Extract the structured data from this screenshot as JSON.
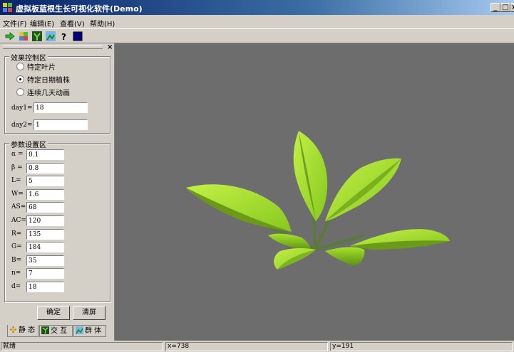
{
  "window": {
    "title": "虚拟板蓝根生长可视化软件(Demo)",
    "minimize_label": "_",
    "maximize_label": "□",
    "close_label": "×"
  },
  "menu": [
    {
      "label": "文件(F)"
    },
    {
      "label": "编辑(E)"
    },
    {
      "label": "查看(V)"
    },
    {
      "label": "帮助(H)"
    }
  ],
  "toolbar": {
    "icons": [
      "arrow-right-icon",
      "grid-icon",
      "plant-icon",
      "image-icon",
      "help-icon",
      "color-icon"
    ]
  },
  "panel": {
    "close_label": "×",
    "effect_group": {
      "title": "效果控制区",
      "options": [
        {
          "label": "特定叶片",
          "selected": false
        },
        {
          "label": "特定日期植株",
          "selected": true
        },
        {
          "label": "连续几天动画",
          "selected": false
        }
      ],
      "day1_label": "day1=",
      "day1_value": "18",
      "day2_label": "day2=",
      "day2_value": "1"
    },
    "param_group": {
      "title": "参数设置区",
      "fields": [
        {
          "label": "α =",
          "value": "0.1"
        },
        {
          "label": "β =",
          "value": "0.8"
        },
        {
          "label": "L=",
          "value": "5"
        },
        {
          "label": "W=",
          "value": "1.6"
        },
        {
          "label": "AS=",
          "value": "68"
        },
        {
          "label": "AC=",
          "value": "120"
        },
        {
          "label": "R=",
          "value": "135"
        },
        {
          "label": "G=",
          "value": "184"
        },
        {
          "label": "B=",
          "value": "35"
        },
        {
          "label": "n=",
          "value": "7"
        },
        {
          "label": "d=",
          "value": "18"
        }
      ]
    },
    "confirm_label": "确定",
    "clear_label": "清屏",
    "tabs": [
      {
        "label": "静 态",
        "icon": "static-icon"
      },
      {
        "label": "交 互",
        "icon": "interact-icon"
      },
      {
        "label": "群 体",
        "icon": "group-icon"
      }
    ]
  },
  "viewport": {
    "background_color": "#6d6d6d",
    "leaf_color": "#a8e62a"
  },
  "status": {
    "ready": "就绪",
    "x": "x=738",
    "y": "y=191"
  }
}
